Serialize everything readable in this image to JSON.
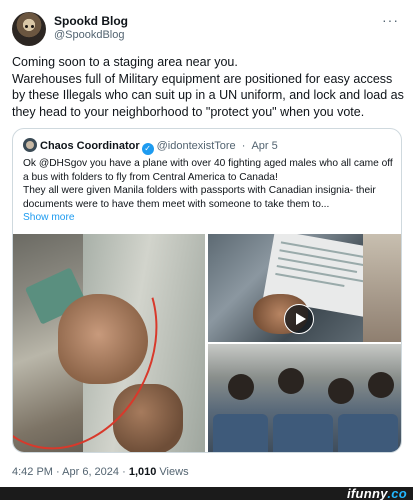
{
  "author": {
    "name": "Spookd Blog",
    "handle": "@SpookdBlog",
    "more_icon": "more-horizontal-icon"
  },
  "tweet": {
    "lines": [
      "Coming soon to a staging area near you.",
      "Warehouses full of Military equipment are positioned for easy access by these Illegals who can suit up in a UN uniform, and lock and load as they head to your neighborhood to \"protect you\" when you vote."
    ]
  },
  "quote": {
    "name": "Chaos Coordinator",
    "verified_icon": "verified-badge-icon",
    "handle": "@idontexistTore",
    "separator": "·",
    "date": "Apr 5",
    "lines": [
      "Ok @DHSgov you have a plane with over 40 fighting aged males who all came off a bus with folders to fly from Central America to Canada!",
      "They all were given Manila folders with passports with Canadian insignia- their documents were to have them meet with someone to take them to..."
    ],
    "show_more": "Show more",
    "media": {
      "play_icon": "play-icon"
    }
  },
  "meta": {
    "time": "4:42 PM",
    "separator": "·",
    "date": "Apr 6, 2024",
    "separator2": "·",
    "views_count": "1,010",
    "views_label": "Views"
  },
  "watermark": {
    "brand": "ifunny",
    "suffix": ".co"
  },
  "colors": {
    "accent": "#1d9bf0",
    "text": "#0f1419",
    "muted": "#536471",
    "border": "#cfd9de",
    "annotation_circle": "#d8392b"
  }
}
